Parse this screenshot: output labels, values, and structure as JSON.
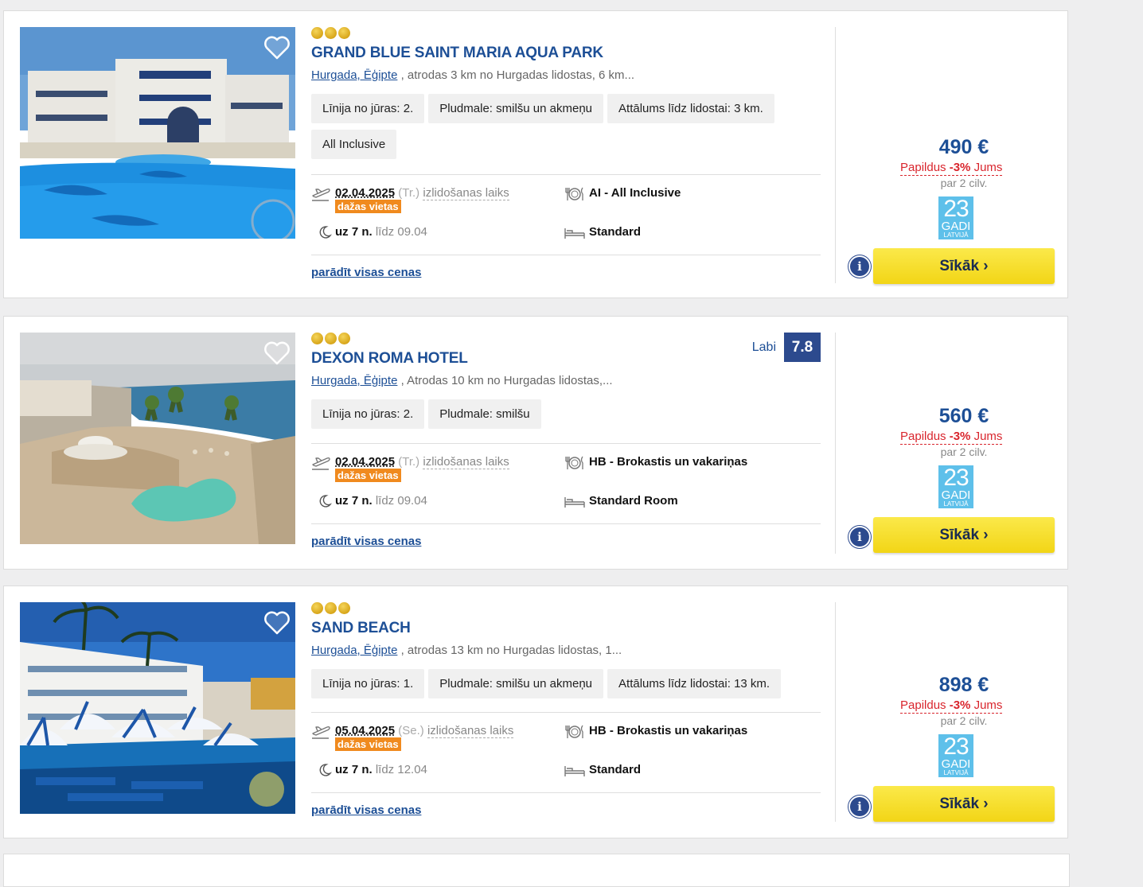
{
  "hotels": [
    {
      "name": "GRAND BLUE SAINT MARIA AQUA PARK",
      "stars": 3,
      "location_link": "Hurgada, Ēģipte",
      "location_rest": " , atrodas 3 km no Hurgadas lidostas, 6 km...",
      "tags": [
        "Līnija no jūras: 2.",
        "Pludmale: smilšu un akmeņu",
        "Attālums līdz lidostai: 3 km.",
        "All Inclusive"
      ],
      "date": "02.04.2025",
      "weekday": "(Tr.)",
      "departure_label": "izlidošanas laiks",
      "few_places": "dažas vietas",
      "nights": "uz 7 n.",
      "until": "līdz 09.04",
      "meal": "AI - All Inclusive",
      "room": "Standard",
      "all_prices": "parādīt visas cenas",
      "price": "490 €",
      "promo_prefix": "Papildus ",
      "promo_pct": "-3%",
      "promo_suffix": " Jums",
      "per_people": "par 2 cilv.",
      "more": "Sīkāk ›"
    },
    {
      "name": "DEXON ROMA HOTEL",
      "stars": 3,
      "rating_word": "Labi",
      "rating_score": "7.8",
      "location_link": "Hurgada, Ēģipte",
      "location_rest": " , Atrodas 10 km no Hurgadas lidostas,...",
      "tags": [
        "Līnija no jūras: 2.",
        "Pludmale: smilšu"
      ],
      "date": "02.04.2025",
      "weekday": "(Tr.)",
      "departure_label": "izlidošanas laiks",
      "few_places": "dažas vietas",
      "nights": "uz 7 n.",
      "until": "līdz 09.04",
      "meal": "HB - Brokastis un vakariņas",
      "room": "Standard Room",
      "all_prices": "parādīt visas cenas",
      "price": "560 €",
      "promo_prefix": "Papildus ",
      "promo_pct": "-3%",
      "promo_suffix": " Jums",
      "per_people": "par 2 cilv.",
      "more": "Sīkāk ›"
    },
    {
      "name": "SAND BEACH",
      "stars": 3,
      "location_link": "Hurgada, Ēģipte",
      "location_rest": " , atrodas 13 km no Hurgadas lidostas, 1...",
      "tags": [
        "Līnija no jūras: 1.",
        "Pludmale: smilšu un akmeņu",
        "Attālums līdz lidostai: 13 km."
      ],
      "date": "05.04.2025",
      "weekday": "(Se.)",
      "departure_label": "izlidošanas laiks",
      "few_places": "dažas vietas",
      "nights": "uz 7 n.",
      "until": "līdz 12.04",
      "meal": "HB - Brokastis un vakariņas",
      "room": "Standard",
      "all_prices": "parādīt visas cenas",
      "price": "898 €",
      "promo_prefix": "Papildus ",
      "promo_pct": "-3%",
      "promo_suffix": " Jums",
      "per_people": "par 2 cilv.",
      "more": "Sīkāk ›"
    }
  ],
  "anniversary_logo": {
    "number": "23",
    "word": "GADI",
    "country": "LATVIJĀ"
  },
  "info_icon_glyph": "i",
  "colors": {
    "brand_blue": "#1d4f96",
    "promo_red": "#d9252d",
    "button_yellow": "#f5dc20",
    "badge_orange": "#f08a1e",
    "logo_cyan": "#5ec0ea"
  }
}
